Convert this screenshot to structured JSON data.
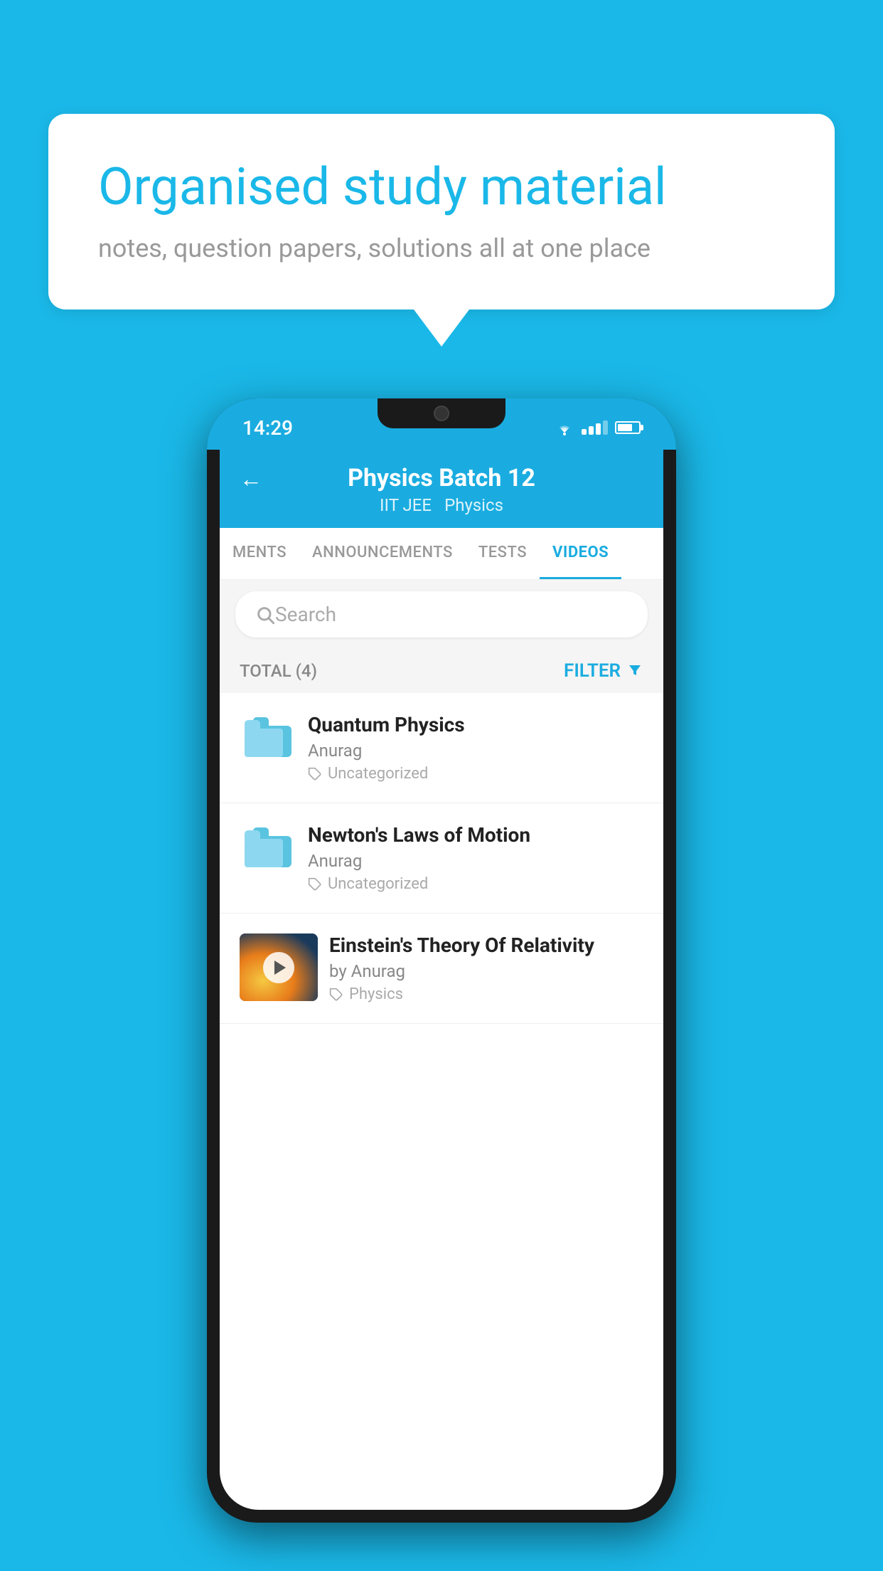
{
  "background_color": "#1ab8e8",
  "speech_bubble": {
    "title": "Organised study material",
    "subtitle": "notes, question papers, solutions all at one place"
  },
  "status_bar": {
    "time": "14:29",
    "icons": [
      "wifi",
      "signal",
      "battery"
    ]
  },
  "app_header": {
    "back_label": "←",
    "title": "Physics Batch 12",
    "subtitle_part1": "IIT JEE",
    "subtitle_part2": "Physics"
  },
  "tabs": [
    {
      "label": "MENTS",
      "active": false
    },
    {
      "label": "ANNOUNCEMENTS",
      "active": false
    },
    {
      "label": "TESTS",
      "active": false
    },
    {
      "label": "VIDEOS",
      "active": true
    }
  ],
  "search": {
    "placeholder": "Search"
  },
  "total_filter": {
    "total_label": "TOTAL (4)",
    "filter_label": "FILTER"
  },
  "videos": [
    {
      "id": 1,
      "title": "Quantum Physics",
      "author": "Anurag",
      "tag": "Uncategorized",
      "has_thumb": false
    },
    {
      "id": 2,
      "title": "Newton's Laws of Motion",
      "author": "Anurag",
      "tag": "Uncategorized",
      "has_thumb": false
    },
    {
      "id": 3,
      "title": "Einstein's Theory Of Relativity",
      "author": "by Anurag",
      "tag": "Physics",
      "has_thumb": true
    }
  ]
}
